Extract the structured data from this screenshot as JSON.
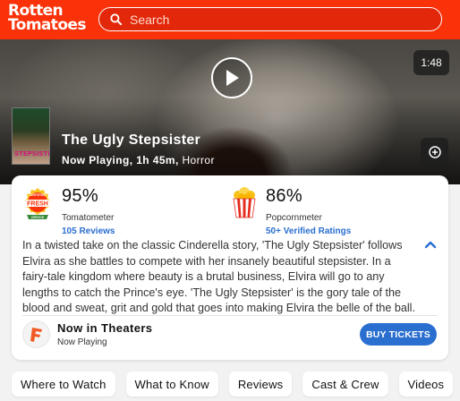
{
  "header": {
    "logo_line1": "Rotten",
    "logo_line2": "Tomatoes",
    "search_placeholder": "Search",
    "brand_color": "#fa320a"
  },
  "hero": {
    "duration": "1:48",
    "play_icon": "play-icon",
    "add_icon": "plus-circle-icon",
    "poster_title": "STEPSISTER",
    "title": "The Ugly Stepsister",
    "status": "Now Playing,",
    "runtime": "1h 45m,",
    "genre": "Horror"
  },
  "scores": {
    "tomatometer": {
      "value": "95%",
      "label": "Tomatometer",
      "reviews": "105 Reviews",
      "badge_top": "CERTIFIED",
      "badge_main": "FRESH",
      "badge_bottom": "CRITICS"
    },
    "popcornmeter": {
      "value": "86%",
      "label": "Popcornmeter",
      "ratings": "50+ Verified Ratings"
    }
  },
  "description": "In a twisted take on the classic Cinderella story, 'The Ugly Stepsister' follows Elvira as she battles to compete with her insanely beautiful stepsister. In a fairy-tale kingdom where beauty is a brutal business, Elvira will go to any lengths to catch the Prince's eye. 'The Ugly Stepsister' is the gory tale of the blood and sweat, grit and gold that goes into making Elvira the belle of the ball.",
  "theaters": {
    "title": "Now in Theaters",
    "subtitle": "Now Playing",
    "button": "BUY TICKETS"
  },
  "nav": [
    "Where to Watch",
    "What to Know",
    "Reviews",
    "Cast & Crew",
    "Videos"
  ],
  "colors": {
    "link_blue": "#2a6ecf",
    "fandango_orange": "#f15a24"
  }
}
